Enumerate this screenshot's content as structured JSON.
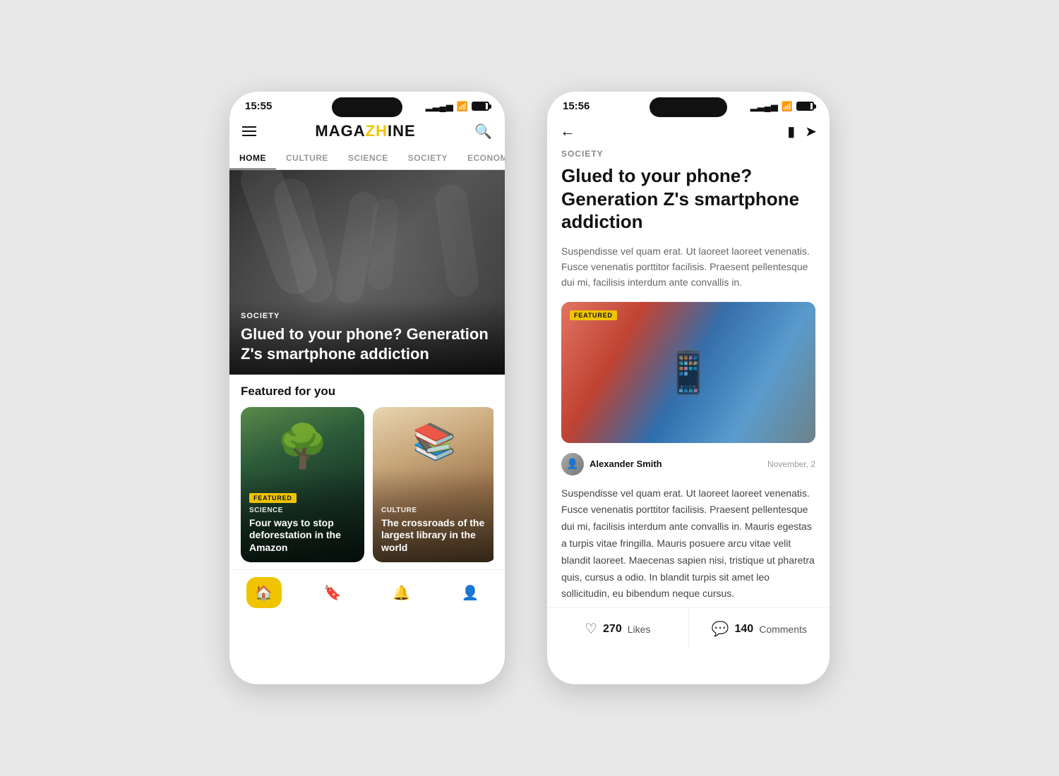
{
  "left_phone": {
    "status_bar": {
      "time": "15:55",
      "signal": "▂▃▄▅",
      "wifi": "WiFi",
      "battery": "85"
    },
    "logo": {
      "part1": "MAGA",
      "part2": "ZH",
      "part3": "INE"
    },
    "nav_tabs": [
      {
        "label": "HOME",
        "active": true
      },
      {
        "label": "CULTURE",
        "active": false
      },
      {
        "label": "SCIENCE",
        "active": false
      },
      {
        "label": "SOCIETY",
        "active": false
      },
      {
        "label": "ECONOM",
        "active": false
      }
    ],
    "hero": {
      "category": "SOCIETY",
      "title": "Glued to your phone? Generation Z's smartphone addiction",
      "dots": [
        true,
        false,
        false
      ]
    },
    "featured_section": {
      "title": "Featured for you",
      "cards": [
        {
          "badge": "FEATURED",
          "category": "SCIENCE",
          "title": "Four ways to stop deforestation in the Amazon",
          "bg": "forest"
        },
        {
          "badge": null,
          "category": "CULTURE",
          "title": "The crossroads of the largest library in the world",
          "bg": "library"
        }
      ]
    },
    "bottom_nav": [
      {
        "icon": "🏠",
        "label": "home",
        "active": true
      },
      {
        "icon": "🔖",
        "label": "bookmark",
        "active": false
      },
      {
        "icon": "🔔",
        "label": "notifications",
        "active": false
      },
      {
        "icon": "👤",
        "label": "profile",
        "active": false
      }
    ]
  },
  "right_phone": {
    "status_bar": {
      "time": "15:56"
    },
    "article": {
      "category": "SOCIETY",
      "title": "Glued to your phone? Generation Z's smartphone addiction",
      "intro": "Suspendisse vel quam erat. Ut laoreet laoreet venenatis. Fusce venenatis porttitor facilisis. Praesent pellentesque dui mi, facilisis interdum ante convallis in.",
      "featured_badge": "FEATURED",
      "author": {
        "name": "Alexander Smith",
        "avatar": "👤"
      },
      "date": "November, 2",
      "body": "Suspendisse vel quam erat. Ut laoreet laoreet venenatis. Fusce venenatis porttitor facilisis. Praesent pellentesque dui mi, facilisis interdum ante convallis in. Mauris egestas a turpis vitae fringilla. Mauris posuere arcu vitae velit blandit laoreet. Maecenas sapien nisi, tristique ut pharetra quis, cursus a odio. In blandit turpis sit amet leo sollicitudin, eu bibendum neque cursus."
    },
    "bottom_bar": {
      "likes_count": "270",
      "likes_label": "Likes",
      "comments_count": "140",
      "comments_label": "Comments"
    }
  }
}
